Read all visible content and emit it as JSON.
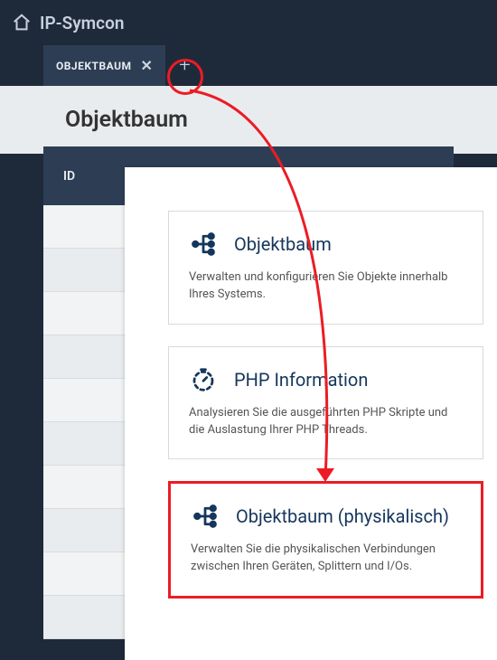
{
  "header": {
    "app_title": "IP-Symcon"
  },
  "tabs": {
    "active": {
      "label": "OBJEKTBAUM"
    }
  },
  "subheader": {
    "title": "Objektbaum"
  },
  "table": {
    "columns": {
      "id": "ID"
    }
  },
  "cards": [
    {
      "title": "Objektbaum",
      "description": "Verwalten und konfigurieren Sie Objekte innerhalb Ihres Systems."
    },
    {
      "title": "PHP Information",
      "description": "Analysieren Sie die ausgeführten PHP Skripte und die Auslastung Ihrer PHP Threads."
    },
    {
      "title": "Objektbaum (physikalisch)",
      "description": "Verwalten Sie die physikalischen Verbindungen zwischen Ihren Geräten, Splittern und I/Os."
    }
  ]
}
